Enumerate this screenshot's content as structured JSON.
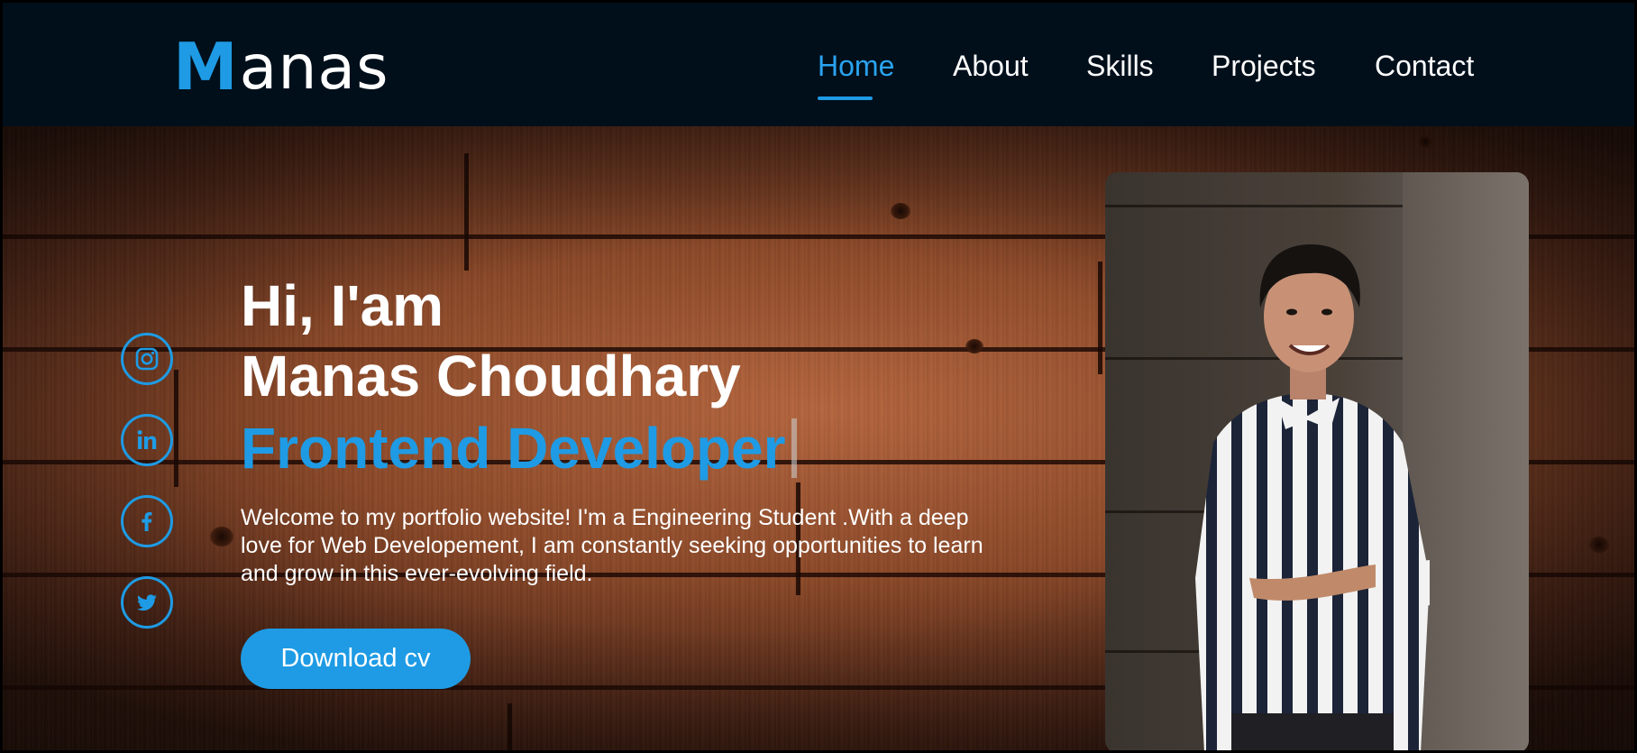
{
  "logo": {
    "first_letter": "M",
    "rest": "anas"
  },
  "nav": {
    "items": [
      {
        "label": "Home",
        "active": true
      },
      {
        "label": "About",
        "active": false
      },
      {
        "label": "Skills",
        "active": false
      },
      {
        "label": "Projects",
        "active": false
      },
      {
        "label": "Contact",
        "active": false
      }
    ]
  },
  "social": [
    {
      "icon": "instagram-icon"
    },
    {
      "icon": "linkedin-icon"
    },
    {
      "icon": "facebook-icon"
    },
    {
      "icon": "twitter-icon"
    }
  ],
  "hero": {
    "greeting": "Hi, I'am",
    "name": "Manas Choudhary",
    "role": "Frontend Developer",
    "description": "Welcome to my portfolio website! I'm a Engineering Student .With a deep love for Web Developement, I am constantly seeking opportunities to learn and grow in this ever-evolving field.",
    "cta_label": "Download cv"
  },
  "colors": {
    "accent": "#1e9be4",
    "header_bg": "#010f1b",
    "text": "#ffffff"
  }
}
